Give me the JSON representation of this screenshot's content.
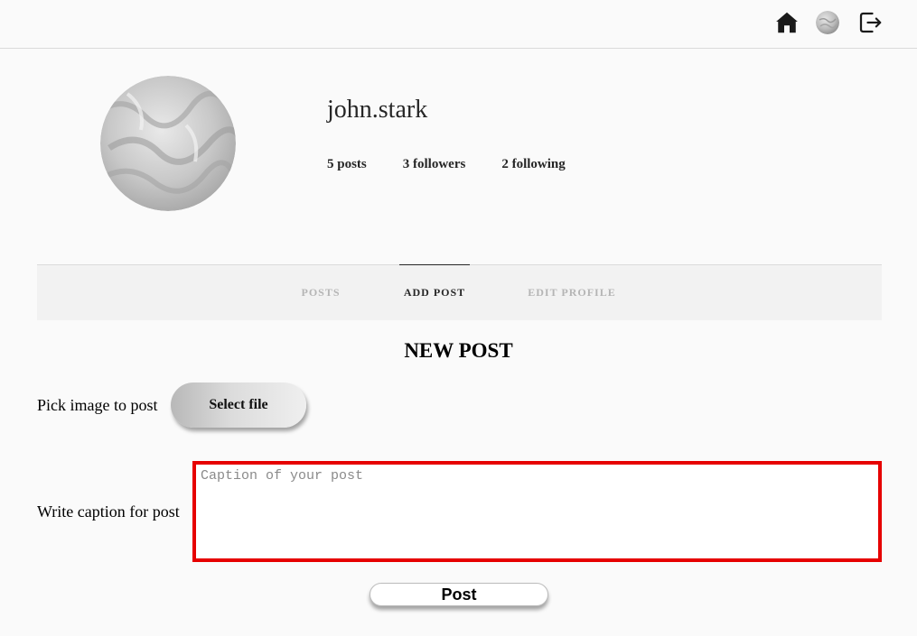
{
  "colors": {
    "accent_border": "#e60000",
    "active_tab": "#262626",
    "inactive_tab": "#b5b5b5"
  },
  "nav": {
    "home_icon": "home-icon",
    "avatar_icon": "avatar",
    "logout_icon": "logout-icon"
  },
  "profile": {
    "username": "john.stark",
    "posts": "5 posts",
    "followers": "3 followers",
    "following": "2 following"
  },
  "tabs": [
    {
      "label": "POSTS",
      "active": false
    },
    {
      "label": "ADD POST",
      "active": true
    },
    {
      "label": "EDIT PROFILE",
      "active": false
    }
  ],
  "new_post": {
    "title": "NEW POST",
    "pick_label": "Pick image to post",
    "select_file": "Select file",
    "caption_label": "Write caption for post",
    "caption_placeholder": "Caption of your post",
    "caption_value": "",
    "post_button": "Post"
  }
}
